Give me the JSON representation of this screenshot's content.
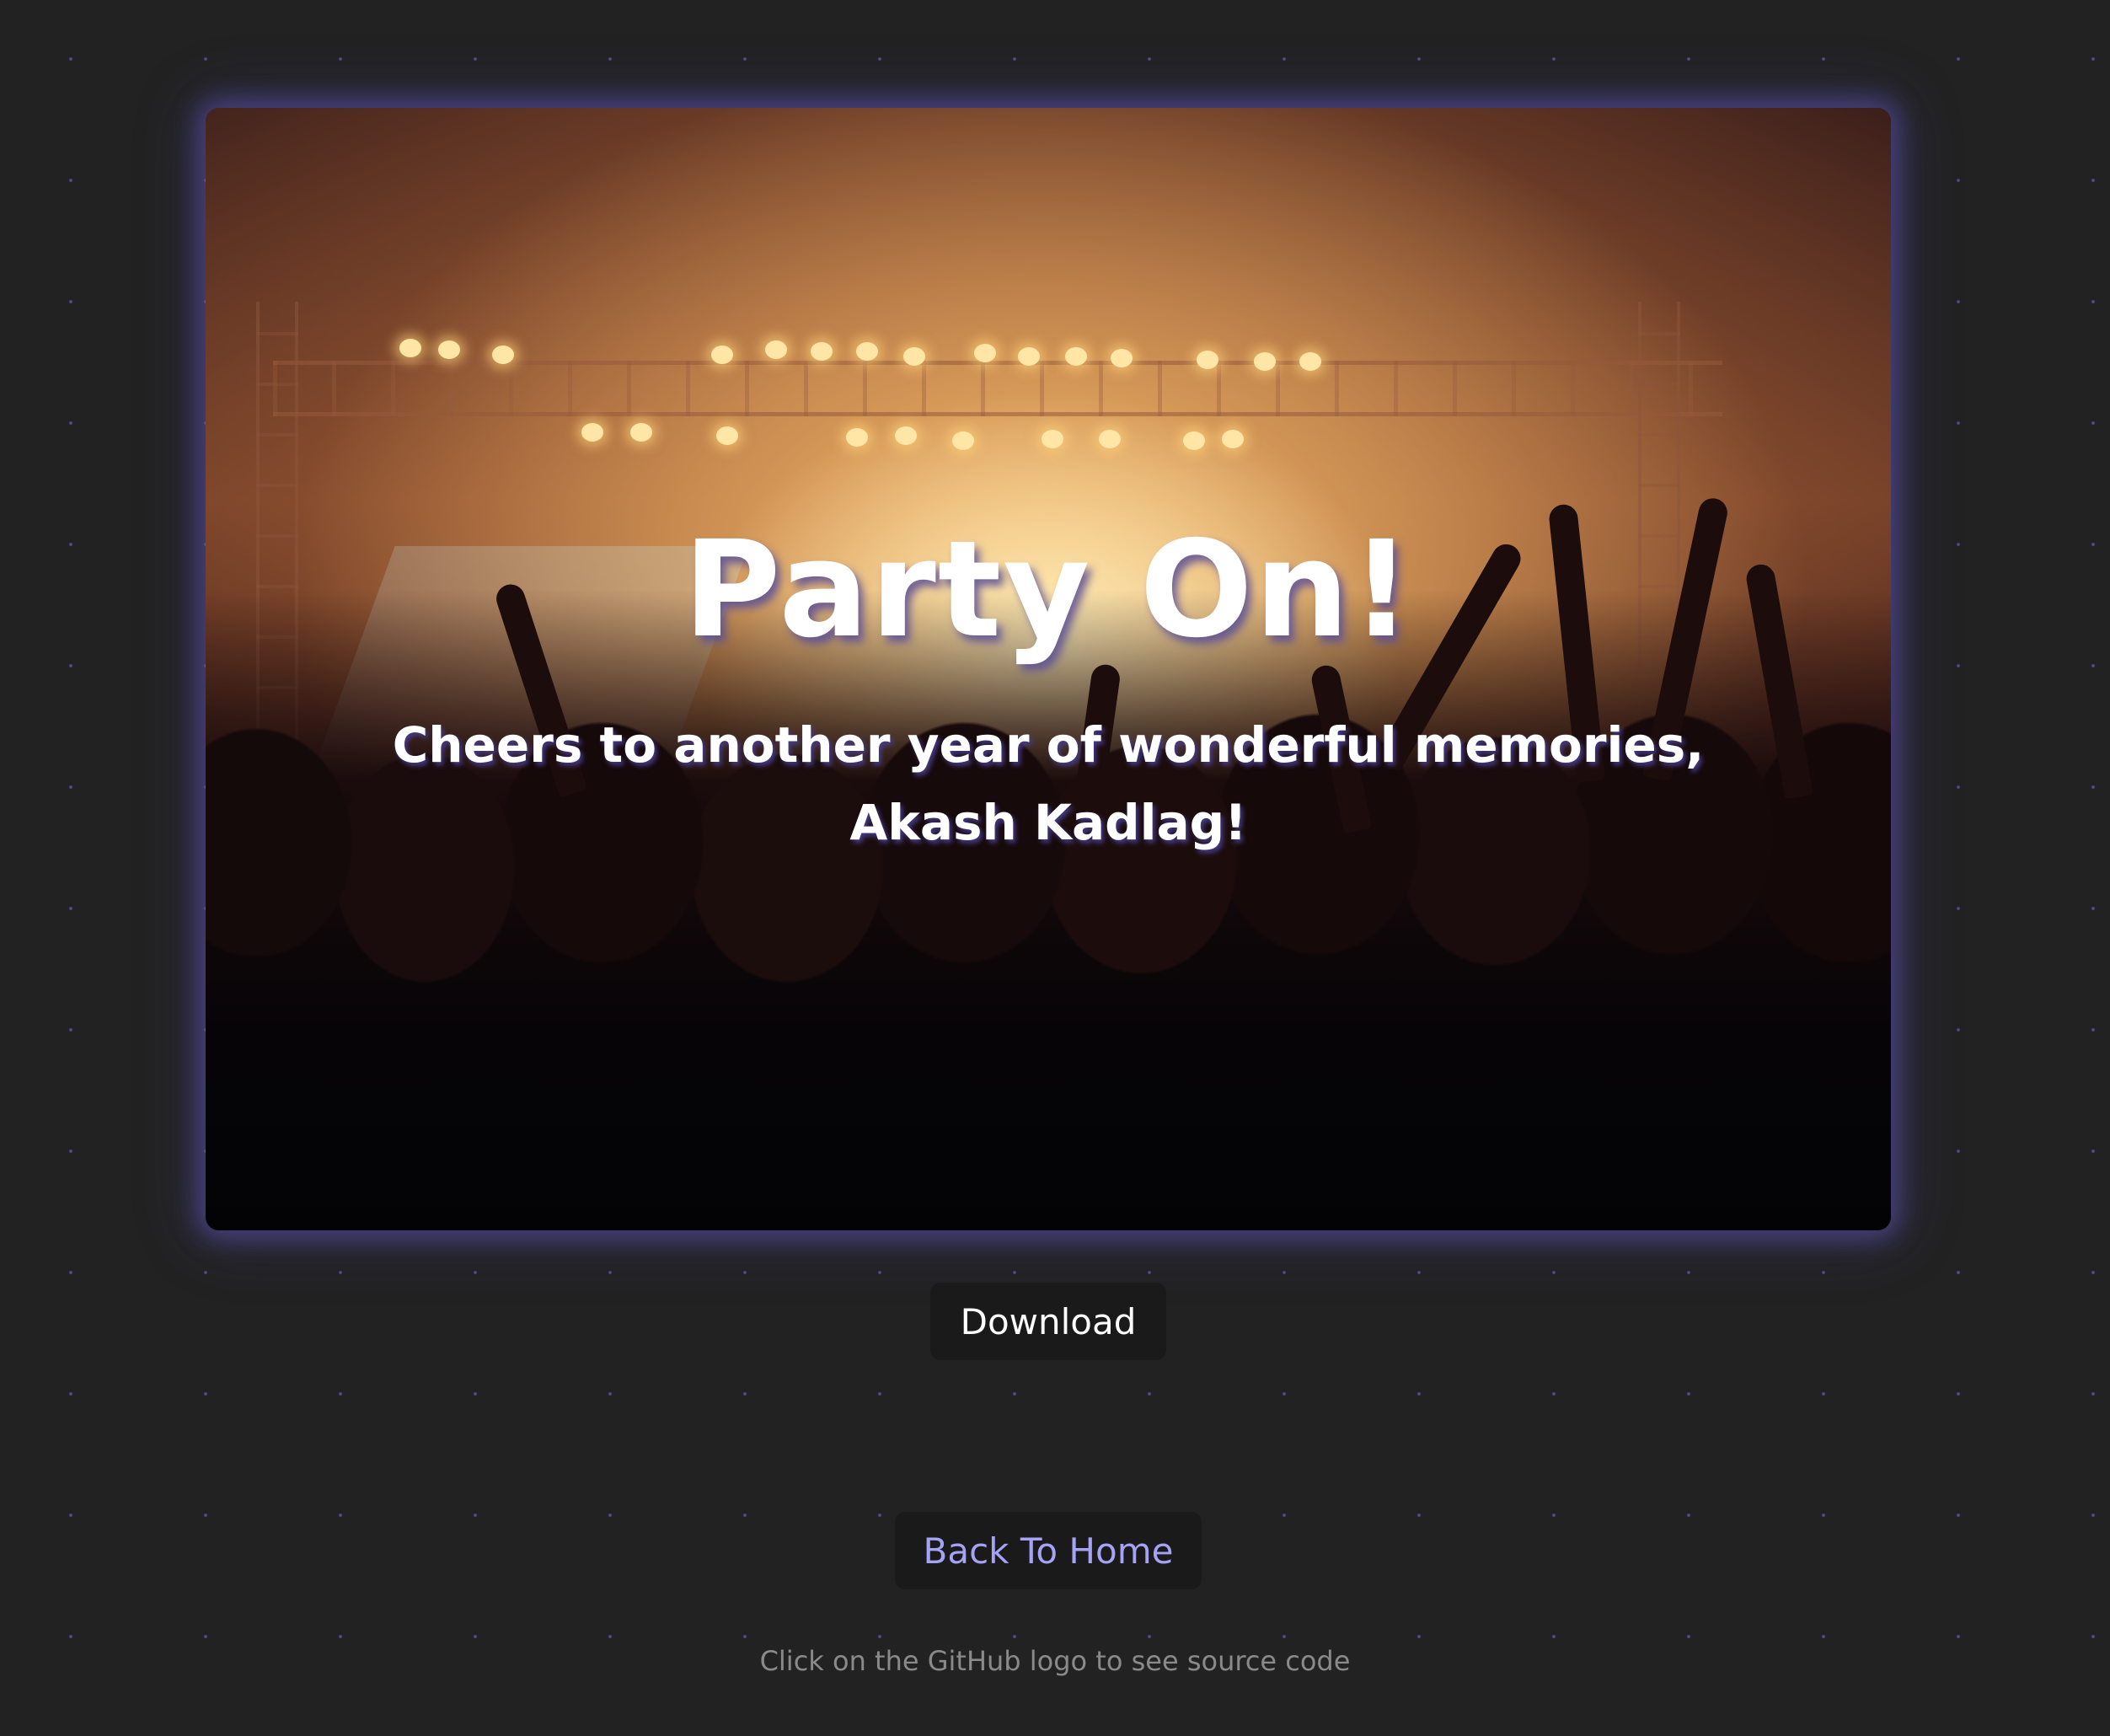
{
  "card": {
    "image_name": "concert-crowd-photo",
    "title": "Party On!",
    "subtitle": "Cheers to another year of wonderful memories, Akash Kadlag!"
  },
  "actions": {
    "download_label": "Download",
    "home_label": "Back To Home"
  },
  "footer": {
    "note": "Click on the GitHub logo to see source code"
  },
  "colors": {
    "background": "#222222",
    "dot_accent": "#786edc",
    "button_bg": "#1a1a1a",
    "link_accent": "#a5a3f5",
    "footer_text": "#8a8a8a"
  }
}
